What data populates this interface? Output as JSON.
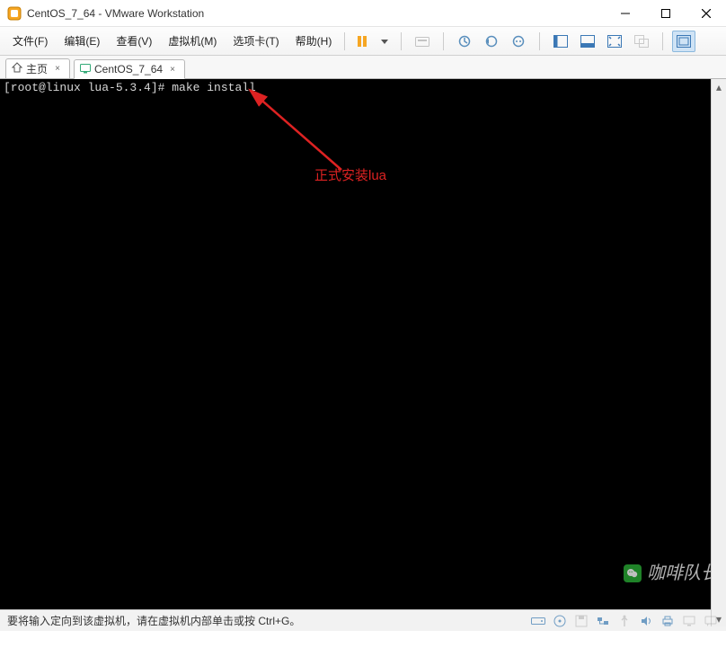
{
  "titlebar": {
    "title": "CentOS_7_64 - VMware Workstation"
  },
  "menu": {
    "file": "文件(F)",
    "edit": "编辑(E)",
    "view": "查看(V)",
    "vm": "虚拟机(M)",
    "tabs": "选项卡(T)",
    "help": "帮助(H)"
  },
  "toolbar_icons": {
    "pause": "pause",
    "power_menu": "power-dropdown",
    "snapshot": "snapshot",
    "snapshot_take": "snapshot-take",
    "snapshot_manage": "snapshot-manage",
    "snapshot_revert": "snapshot-revert",
    "layout1": "layout-single",
    "layout2": "layout-thumb",
    "layout3": "layout-tile",
    "unity": "unity",
    "fullscreen": "fullscreen"
  },
  "tabs": [
    {
      "label": "主页",
      "icon": "home-icon",
      "active": false
    },
    {
      "label": "CentOS_7_64",
      "icon": "vm-icon",
      "active": true
    }
  ],
  "terminal": {
    "prompt": "[root@linux lua-5.3.4]# ",
    "command": "make install"
  },
  "annotation": {
    "text": "正式安装lua"
  },
  "statusbar": {
    "hint": "要将输入定向到该虚拟机，请在虚拟机内部单击或按 Ctrl+G。"
  },
  "watermark": {
    "text": "咖啡队长"
  }
}
